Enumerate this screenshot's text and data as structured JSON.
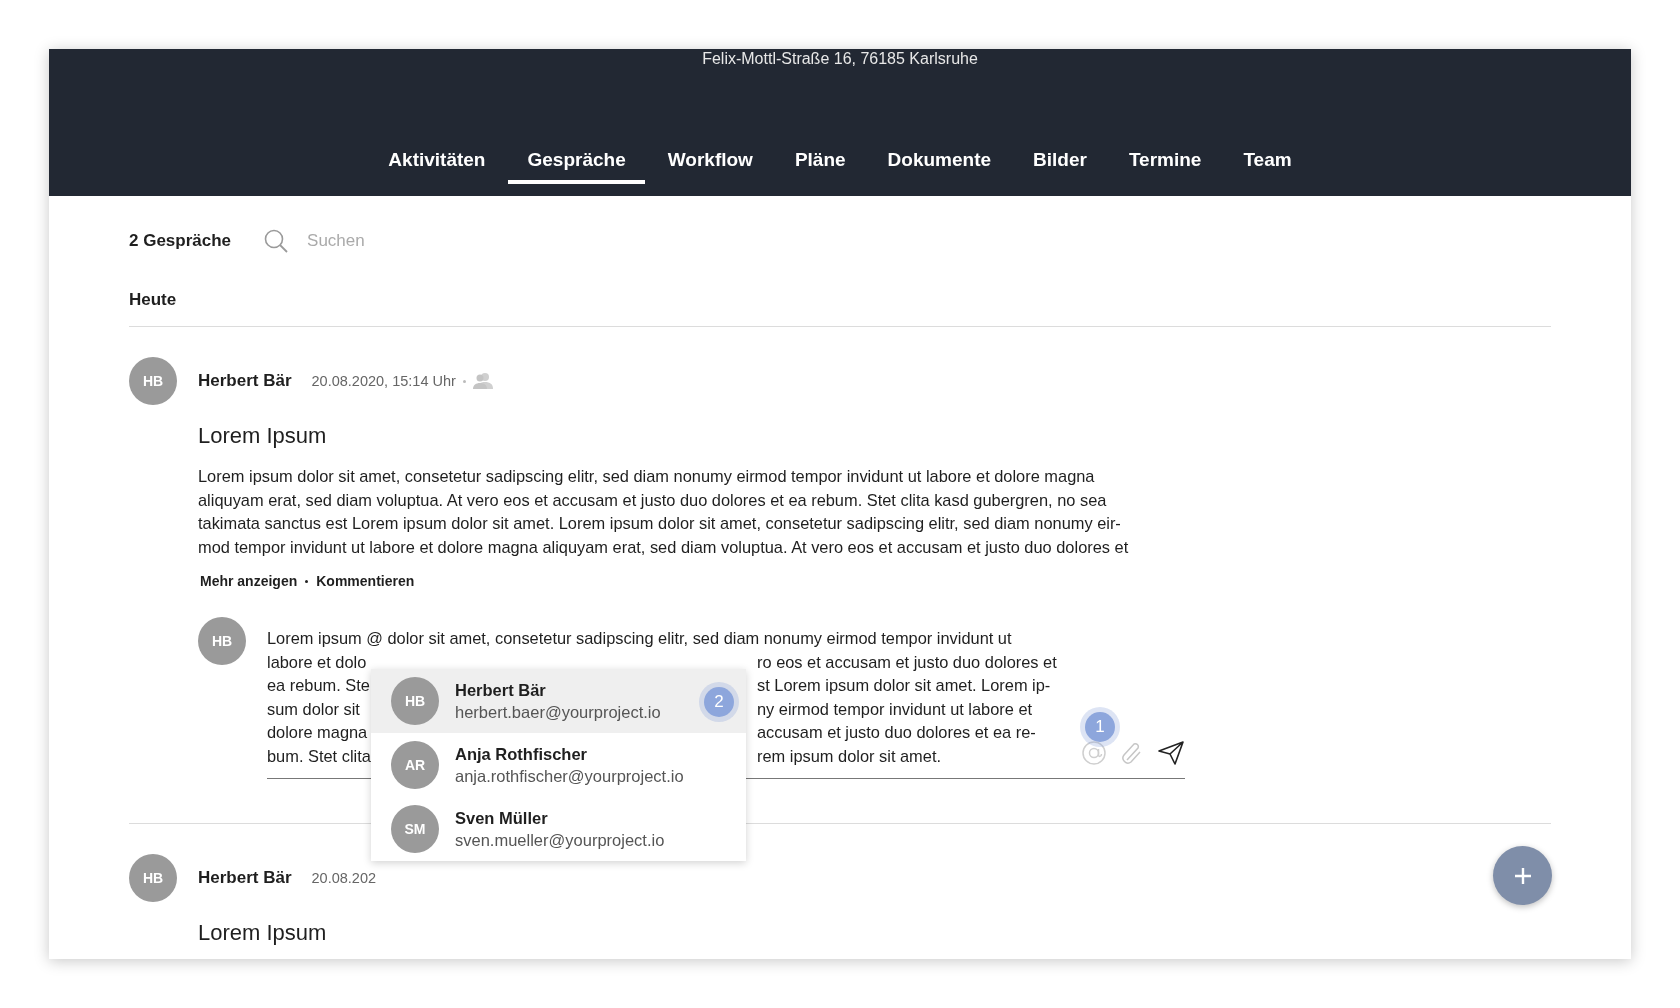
{
  "header": {
    "address": "Felix-Mottl-Straße 16, 76185 Karlsruhe"
  },
  "tabs": [
    {
      "label": "Aktivitäten",
      "selected": false
    },
    {
      "label": "Gespräche",
      "selected": true
    },
    {
      "label": "Workflow",
      "selected": false
    },
    {
      "label": "Pläne",
      "selected": false
    },
    {
      "label": "Dokumente",
      "selected": false
    },
    {
      "label": "Bilder",
      "selected": false
    },
    {
      "label": "Termine",
      "selected": false
    },
    {
      "label": "Team",
      "selected": false
    }
  ],
  "toolbar": {
    "count": "2 Gespräche",
    "search": {
      "placeholder": "Suchen"
    }
  },
  "section": "Heute",
  "posts": [
    {
      "initials": "HB",
      "author": "Herbert Bär",
      "date": "20.08.2020, 15:14 Uhr",
      "title": "Lorem Ipsum",
      "body_lines": [
        "Lorem ipsum dolor sit amet, consetetur sadipscing elitr, sed diam nonumy eirmod tempor invidunt ut labore et dolore magna",
        "aliquyam erat, sed diam voluptua. At vero eos et accusam et justo duo dolores et ea rebum. Stet clita kasd gubergren, no sea",
        "takimata sanctus est Lorem ipsum dolor sit amet. Lorem ipsum dolor sit amet, consetetur sadipscing elitr, sed diam nonumy eir-",
        "mod tempor invidunt ut labore et dolore magna aliquyam erat, sed diam voluptua. At vero eos et accusam et justo duo dolores et"
      ],
      "actions": [
        "Mehr anzeigen",
        "Kommentieren"
      ],
      "comment": {
        "initials": "HB",
        "lines": [
          {
            "start": "Lorem ipsum @ dolor sit amet, consetetur sadipscing elitr, sed diam nonumy eirmod tempor invidunt ut"
          },
          {
            "start": "labore et dolo",
            "end": "ro eos et accusam et justo duo dolores et"
          },
          {
            "start": "ea rebum. Ste",
            "end": "st Lorem ipsum dolor sit amet. Lorem ip-"
          },
          {
            "start": "sum dolor sit",
            "end": "ny eirmod tempor invidunt ut labore et"
          },
          {
            "start": "dolore magna",
            "end": "accusam et justo duo dolores et ea re-"
          },
          {
            "start": "bum. Stet clita",
            "end": "rem ipsum dolor sit amet."
          }
        ],
        "marker": "1",
        "mentions": [
          {
            "initials": "HB",
            "name": "Herbert Bär",
            "email": "herbert.baer@yourproject.io",
            "selected": true,
            "marker": "2"
          },
          {
            "initials": "AR",
            "name": "Anja Rothfischer",
            "email": "anja.rothfischer@yourproject.io",
            "selected": false
          },
          {
            "initials": "SM",
            "name": "Sven Müller",
            "email": "sven.mueller@yourproject.io",
            "selected": false
          }
        ]
      }
    },
    {
      "initials": "HB",
      "author": "Herbert Bär",
      "date": "20.08.202",
      "title": "Lorem Ipsum"
    }
  ]
}
